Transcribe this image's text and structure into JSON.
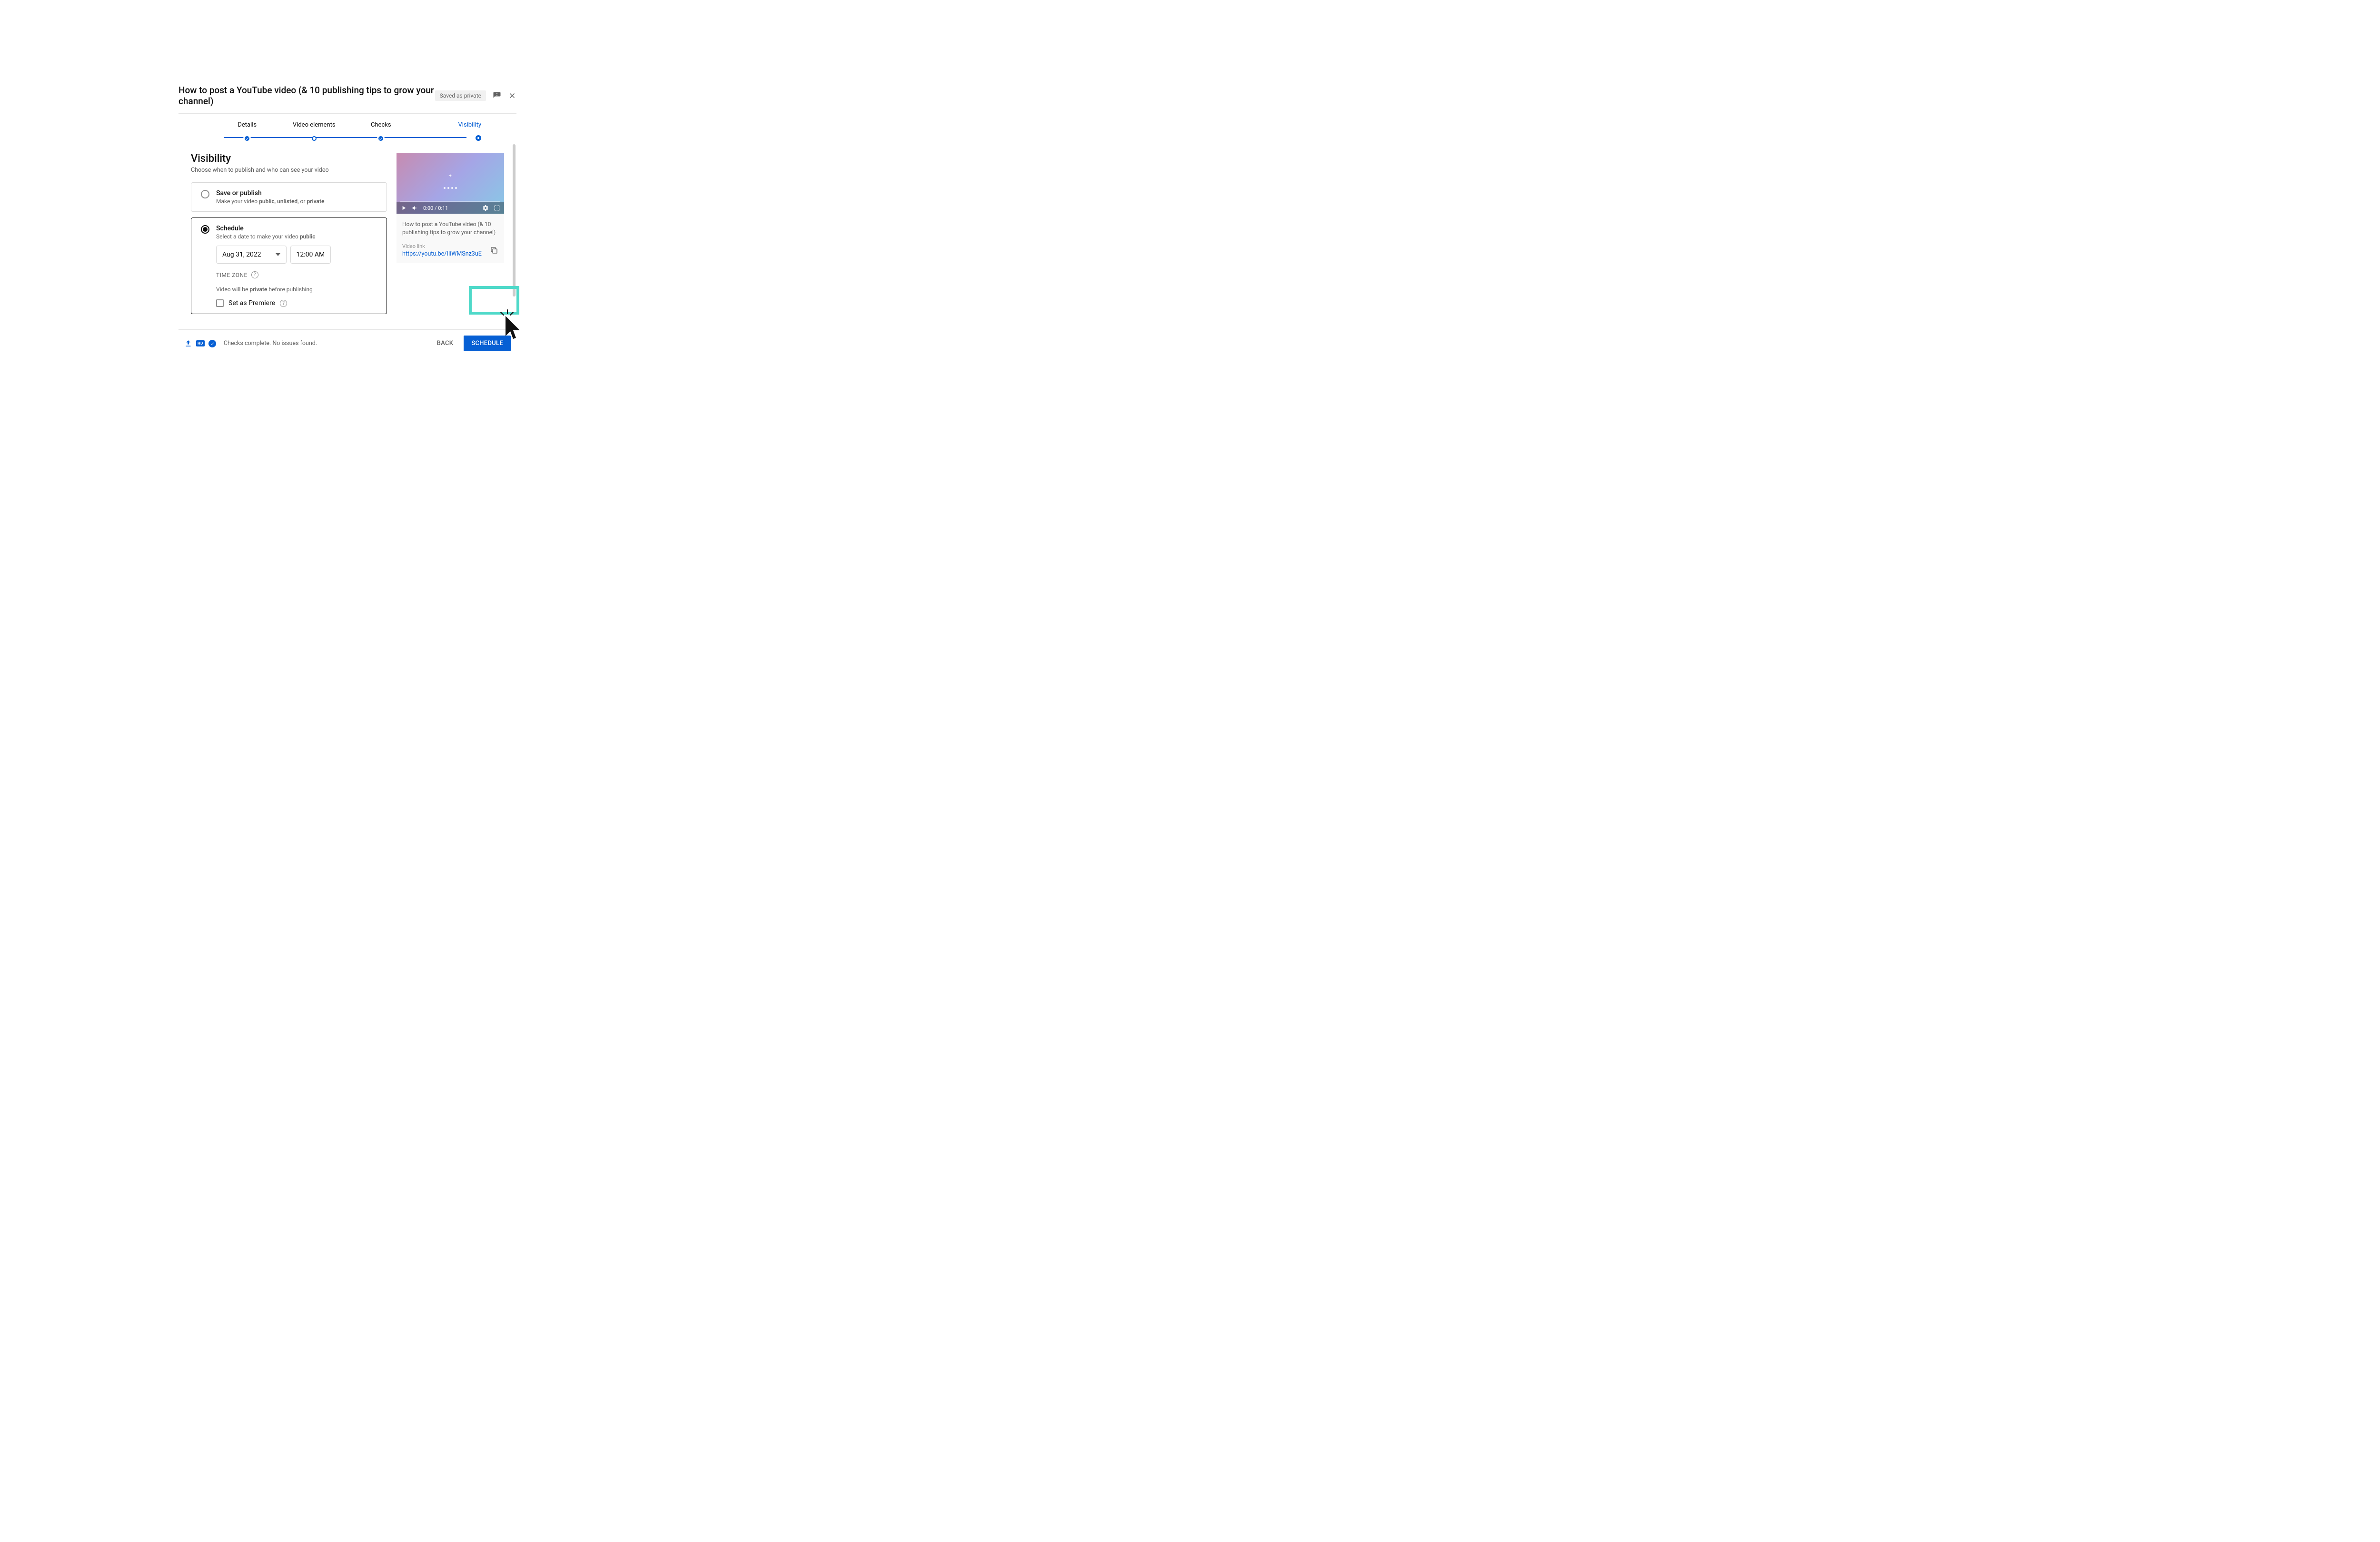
{
  "header": {
    "title": "How to post a YouTube video (& 10 publishing tips to grow your channel)",
    "saved_chip": "Saved as private"
  },
  "stepper": {
    "steps": [
      "Details",
      "Video elements",
      "Checks",
      "Visibility"
    ]
  },
  "section": {
    "title": "Visibility",
    "subtitle": "Choose when to publish and who can see your video"
  },
  "save_option": {
    "heading": "Save or publish",
    "sub_prefix": "Make your video ",
    "w1": "public",
    "sep1": ", ",
    "w2": "unlisted",
    "sep2": ", or ",
    "w3": "private"
  },
  "schedule_option": {
    "heading": "Schedule",
    "sub_prefix": "Select a date to make your video ",
    "sub_bold": "public",
    "date": "Aug 31, 2022",
    "time": "12:00 AM",
    "timezone_label": "TIME ZONE",
    "private_note_pre": "Video will be ",
    "private_note_bold": "private",
    "private_note_post": " before publishing",
    "premiere_label": "Set as Premiere"
  },
  "preview": {
    "time_text": "0:00 / 0:11",
    "video_title": "How to post a YouTube video (& 10 publishing tips to grow your channel)",
    "link_label": "Video link",
    "link": "https://youtu.be/IIiWMSnz3uE"
  },
  "footer": {
    "hd": "HD",
    "status": "Checks complete. No issues found.",
    "back": "BACK",
    "schedule": "SCHEDULE"
  }
}
